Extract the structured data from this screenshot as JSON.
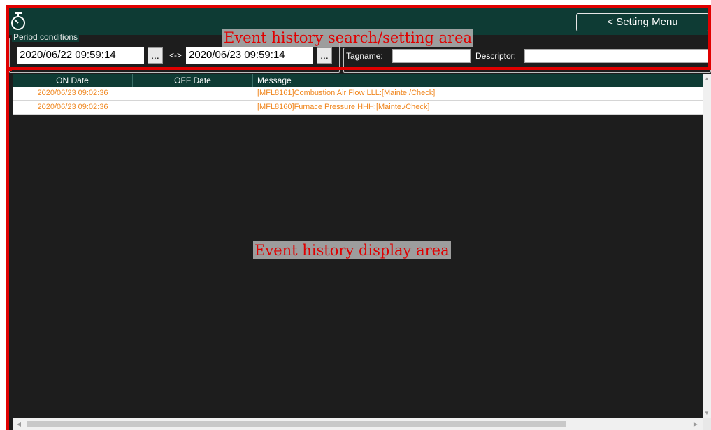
{
  "header": {
    "icon": "stopwatch-icon",
    "setting_button": "< Setting Menu"
  },
  "search": {
    "period_label": "Period conditions",
    "start_date": "2020/06/22 09:59:14",
    "end_date": "2020/06/23 09:59:14",
    "picker_label": "...",
    "range_separator": "<->",
    "tagname_label": "Tagname:",
    "tagname_value": "",
    "descriptor_label": "Descriptor:",
    "descriptor_value": ""
  },
  "table": {
    "columns": [
      "ON Date",
      "OFF Date",
      "Message"
    ],
    "rows": [
      {
        "on_date": "2020/06/23 09:02:36",
        "off_date": "",
        "message": "[MFL8161]Combustion Air Flow LLL:[Mainte./Check]"
      },
      {
        "on_date": "2020/06/23 09:02:36",
        "off_date": "",
        "message": "[MFL8160]Furnace Pressure HHH:[Mainte./Check]"
      }
    ]
  },
  "annotations": {
    "search_area": "Event history search/setting area",
    "display_area": "Event history display area"
  },
  "colors": {
    "header_bg": "#0e3b34",
    "body_bg": "#1d1d1d",
    "event_text": "#f0871f",
    "annotation": "#e00000"
  }
}
